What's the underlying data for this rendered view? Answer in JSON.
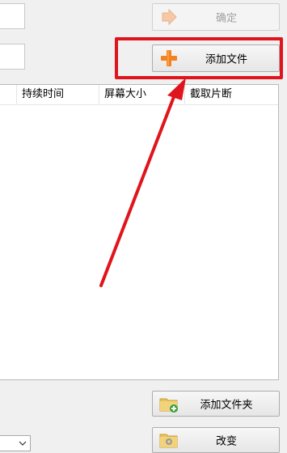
{
  "buttons": {
    "confirm_label": "确定",
    "add_file_label": "添加文件",
    "add_folder_label": "添加文件夹",
    "change_label": "改变"
  },
  "file_list": {
    "columns": [
      "",
      "持续时间",
      "屏幕大小",
      "截取片断"
    ]
  },
  "colors": {
    "highlight": "#e0141c",
    "arrow": "#e0141c",
    "plus_orange": "#f58220",
    "folder_yellow": "#e8c15a"
  },
  "icons": {
    "confirm": "arrow-right-icon",
    "add_file": "plus-icon",
    "add_folder": "folder-add-icon",
    "change": "folder-settings-icon",
    "select": "chevron-down-icon"
  }
}
